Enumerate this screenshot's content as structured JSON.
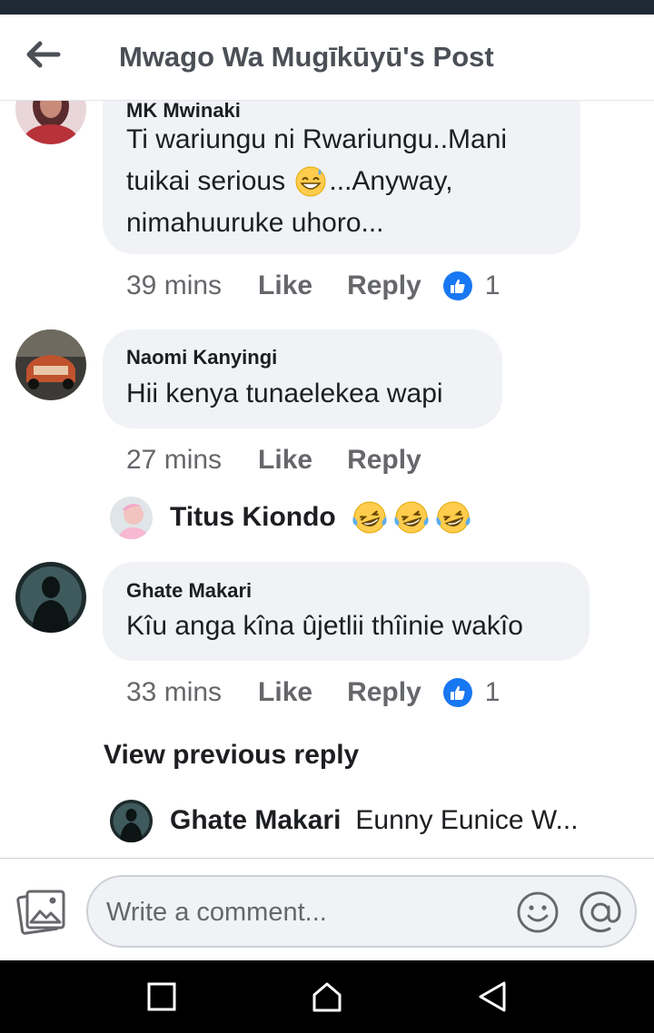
{
  "header": {
    "title": "Mwago Wa Mugīkūyū's Post"
  },
  "comments": [
    {
      "author": "MK Mwinaki",
      "lines": [
        "Ti wariungu ni Rwariungu..Mani",
        "tuikai serious ",
        "nimahuuruke uhoro..."
      ],
      "line2_suffix": "...Anyway,",
      "time": "39 mins",
      "like": "Like",
      "reply": "Reply",
      "reactions": "1"
    },
    {
      "author": "Naomi Kanyingi",
      "text": "Hii kenya tunaelekea wapi",
      "time": "27 mins",
      "like": "Like",
      "reply": "Reply",
      "reply_preview": {
        "name": "Titus Kiondo"
      }
    },
    {
      "author": "Ghate Makari",
      "text": "Kîu anga kîna ûjetlii thîinie wakîo",
      "time": "33 mins",
      "like": "Like",
      "reply": "Reply",
      "reactions": "1",
      "view_previous": "View previous reply",
      "reply_preview": {
        "name": "Ghate Makari",
        "text": "Eunny Eunice W..."
      }
    }
  ],
  "composer": {
    "placeholder": "Write a comment..."
  },
  "colors": {
    "accent": "#1877f2",
    "bubble": "#f0f2f5",
    "meta": "#65676b"
  }
}
